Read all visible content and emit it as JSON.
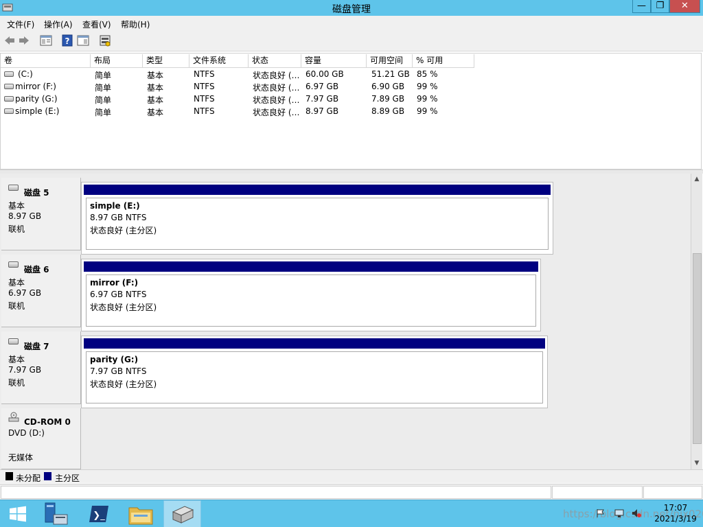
{
  "window": {
    "title": "磁盘管理"
  },
  "title_buttons": {
    "minimize": "—",
    "maximize": "❐",
    "close": "✕"
  },
  "menu": [
    "文件(F)",
    "操作(A)",
    "查看(V)",
    "帮助(H)"
  ],
  "toolbar": {
    "icons": [
      "back-arrow-icon",
      "forward-arrow-icon",
      "properties-icon",
      "help-icon",
      "console-view-icon",
      "disk-settings-icon"
    ],
    "help_glyph": "?"
  },
  "volume_list": {
    "columns": [
      "卷",
      "布局",
      "类型",
      "文件系统",
      "状态",
      "容量",
      "可用空间",
      "% 可用"
    ],
    "rows": [
      [
        "(C:)",
        "简单",
        "基本",
        "NTFS",
        "状态良好 (…",
        "60.00 GB",
        "51.21 GB",
        "85 %"
      ],
      [
        "mirror (F:)",
        "简单",
        "基本",
        "NTFS",
        "状态良好 (…",
        "6.97 GB",
        "6.90 GB",
        "99 %"
      ],
      [
        "parity (G:)",
        "简单",
        "基本",
        "NTFS",
        "状态良好 (…",
        "7.97 GB",
        "7.89 GB",
        "99 %"
      ],
      [
        "simple (E:)",
        "简单",
        "基本",
        "NTFS",
        "状态良好 (…",
        "8.97 GB",
        "8.89 GB",
        "99 %"
      ]
    ]
  },
  "disks": [
    {
      "name": "磁盘 5",
      "type": "基本",
      "size": "8.97 GB",
      "state": "联机",
      "partition": {
        "name": "simple  (E:)",
        "size_fs": "8.97 GB NTFS",
        "status": "状态良好 (主分区)"
      }
    },
    {
      "name": "磁盘 6",
      "type": "基本",
      "size": "6.97 GB",
      "state": "联机",
      "partition": {
        "name": "mirror  (F:)",
        "size_fs": "6.97 GB NTFS",
        "status": "状态良好 (主分区)"
      }
    },
    {
      "name": "磁盘 7",
      "type": "基本",
      "size": "7.97 GB",
      "state": "联机",
      "partition": {
        "name": "parity  (G:)",
        "size_fs": "7.97 GB NTFS",
        "status": "状态良好 (主分区)"
      }
    }
  ],
  "cdrom": {
    "name": "CD-ROM 0",
    "drive": "DVD (D:)",
    "media": "无媒体"
  },
  "legend": {
    "items": [
      {
        "label": "未分配",
        "color": "#000000"
      },
      {
        "label": "主分区",
        "color": "#000080"
      }
    ]
  },
  "scrollbar": {
    "up": "▲",
    "down": "▼"
  },
  "taskbar": {
    "items": [
      "start-icon",
      "server-manager-icon",
      "powershell-icon",
      "file-explorer-icon",
      "disk-management-icon"
    ],
    "powershell_glyph": "❯_"
  },
  "clock": {
    "time": "17:07",
    "date": "2021/3/19"
  },
  "watermark": "https://blog.csdn.net/nix020"
}
